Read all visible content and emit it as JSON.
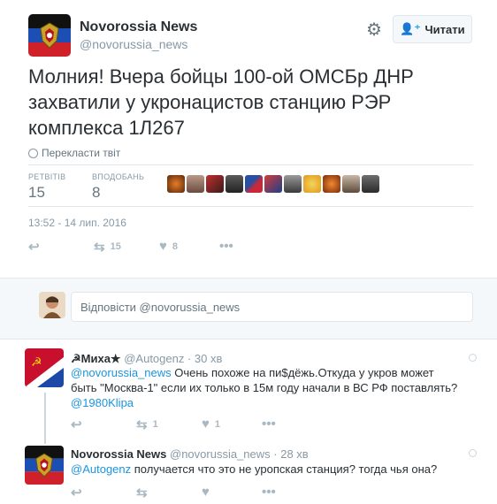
{
  "tweet": {
    "author_name": "Novorossia News",
    "author_handle": "@novorussia_news",
    "follow_label": "Читати",
    "text": "Молния! Вчера бойцы 100-ой ОМСБр ДНР захватили у укронацистов станцию РЭР комплекса 1Л267",
    "translate_label": "Перекласти твіт",
    "stats": {
      "retweets_label": "РЕТВІТІВ",
      "retweets": "15",
      "likes_label": "ВПОДОБАНЬ",
      "likes": "8"
    },
    "timestamp": "13:52 - 14 лип. 2016",
    "actions": {
      "retweet_count": "15",
      "like_count": "8"
    }
  },
  "reply_box": {
    "placeholder": "Відповісти @novorussia_news"
  },
  "replies": [
    {
      "name": "☭Миха★",
      "handle": "@Autogenz",
      "time": "· 30 хв",
      "mention": "@novorussia_news",
      "text": " Очень похоже на пи$дёжь.Откуда у укров может быть \"Москва-1\" если их только в 15м году начали в ВС РФ поставлять?",
      "extra_mention": "@1980Klipa",
      "retweet_count": "1",
      "like_count": "1"
    },
    {
      "name": "Novorossia News",
      "handle": "@novorussia_news",
      "time": "· 28 хв",
      "mention": "@Autogenz",
      "text": " получается что это не уропская станция? тогда чья она?"
    }
  ],
  "icons": {
    "gear": "gear-icon",
    "follow": "person-add-icon",
    "reply": "reply-icon",
    "retweet": "retweet-icon",
    "like": "heart-icon",
    "more": "more-icon",
    "globe": "globe-icon"
  },
  "colors": {
    "link": "#1b95e0",
    "muted": "#8899a6",
    "text": "#292f33"
  }
}
